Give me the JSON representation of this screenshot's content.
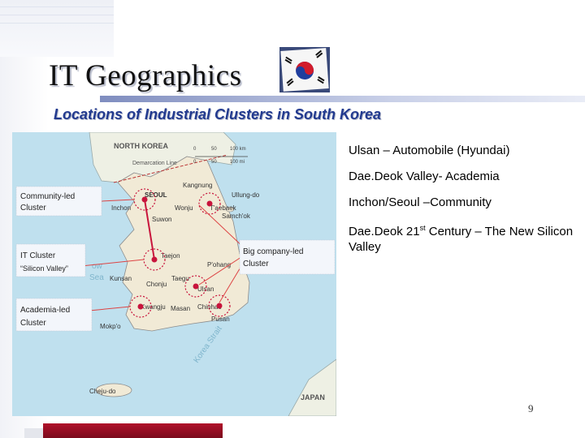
{
  "slide": {
    "title": "IT Geographics",
    "subtitle": "Locations of Industrial Clusters in South Korea",
    "page_number": "9"
  },
  "bullets": [
    {
      "text": "Ulsan – Automobile (Hyundai)"
    },
    {
      "text": "Dae.Deok Valley- Academia"
    },
    {
      "text": "Inchon/Seoul –Community"
    },
    {
      "prefix": "Dae.Deok 21",
      "sup": "st",
      "suffix": " Century – The New Silicon Valley"
    }
  ],
  "map": {
    "regions": {
      "north_korea": "NORTH KOREA",
      "japan": "JAPAN",
      "dmz": "Demarcation Line",
      "sea": "Sea",
      "sea_frag": "ow"
    },
    "scale": {
      "ticks": [
        "0",
        "50",
        "100 km"
      ],
      "miles": [
        "0",
        "50",
        "100 mi"
      ]
    },
    "cities": {
      "seoul": "SEOUL",
      "inchon": "Inchon",
      "suwon": "Suwon",
      "wonju": "Wonju",
      "kangnung": "Kangnung",
      "uliung": "Ullung-do",
      "taebaek": "T'aebaek",
      "samchok": "Samch'ok",
      "taejon": "Taejon",
      "pohang": "P'ohang",
      "kunsan": "Kunsan",
      "chonju": "Chonju",
      "taegu": "Taegu",
      "ulsan": "Ulsan",
      "kwangju": "Kwangju",
      "masan": "Masan",
      "chinhae": "Chinhae",
      "pusan": "Pusan",
      "mokpo": "Mokp'o",
      "chejudo": "Cheju-do",
      "korea_strait": "Korea Strait"
    },
    "callouts": {
      "community": [
        "Community-led",
        "Cluster"
      ],
      "it": [
        "IT Cluster",
        "“Silicon Valley”"
      ],
      "academia": [
        "Academia-led",
        "Cluster"
      ],
      "big": [
        "Big company-led",
        "Cluster"
      ]
    }
  },
  "colors": {
    "title_accent": "#7f8dbf",
    "subtitle": "#223a8f",
    "footer_bar": "#9c0c24",
    "marker": "#c8143c"
  }
}
